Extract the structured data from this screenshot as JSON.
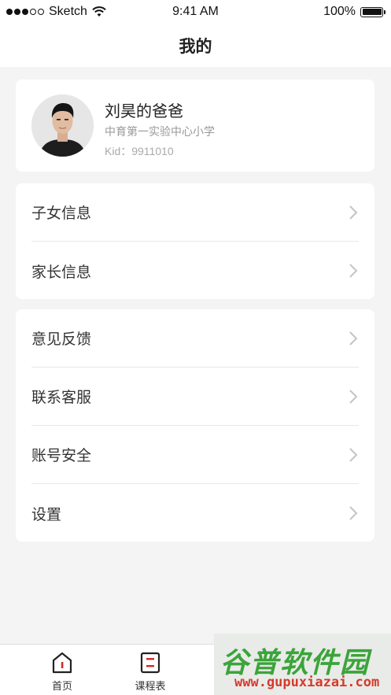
{
  "status_bar": {
    "carrier": "Sketch",
    "time": "9:41 AM",
    "battery": "100%",
    "battery_level": 1.0
  },
  "nav": {
    "title": "我的"
  },
  "profile": {
    "name": "刘昊的爸爸",
    "school": "中育第一实验中心小学",
    "kid": "Kid：9911010"
  },
  "info_section": {
    "items": [
      {
        "label": "子女信息",
        "icon": "chevron-right-icon"
      },
      {
        "label": "家长信息",
        "icon": "chevron-right-icon"
      }
    ]
  },
  "settings_section": {
    "items": [
      {
        "label": "意见反馈",
        "icon": "chevron-right-icon"
      },
      {
        "label": "联系客服",
        "icon": "chevron-right-icon"
      },
      {
        "label": "账号安全",
        "icon": "chevron-right-icon"
      },
      {
        "label": "设置",
        "icon": "chevron-right-icon"
      }
    ]
  },
  "tab_bar": {
    "tabs": [
      {
        "label": "首页",
        "icon": "home-icon"
      },
      {
        "label": "课程表",
        "icon": "schedule-icon"
      }
    ]
  },
  "watermark": {
    "title": "谷普软件园",
    "url": "www.gupuxiazai.com"
  },
  "colors": {
    "background": "#f4f4f4",
    "card": "#ffffff",
    "accent": "#cc2b2b",
    "watermark_green": "#3ba43a",
    "watermark_red": "#d43b2c"
  }
}
